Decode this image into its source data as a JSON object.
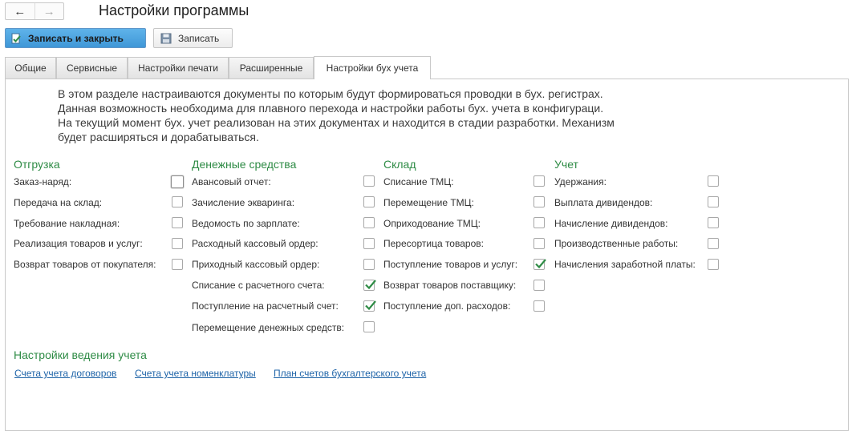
{
  "window": {
    "title": "Настройки программы",
    "nav": {
      "back_icon": "←",
      "forward_icon": "→"
    }
  },
  "toolbar": {
    "save_close_label": "Записать и закрыть",
    "save_label": "Записать"
  },
  "tabs": [
    {
      "label": "Общие",
      "active": false
    },
    {
      "label": "Сервисные",
      "active": false
    },
    {
      "label": "Настройки печати",
      "active": false
    },
    {
      "label": "Расширенные",
      "active": false
    },
    {
      "label": "Настройки бух учета",
      "active": true
    }
  ],
  "description": [
    "В этом разделе настраиваются документы по которым будут формироваться проводки в бух. регистрах.",
    "Данная возможность необходима для плавного перехода и настройки работы бух. учета в конфигураци.",
    "На текущий момент бух. учет реализован на этих документах и находится в стадии разработки. Механизм",
    "будет расширяться и дорабатываться."
  ],
  "sections": [
    {
      "title": "Отгрузка",
      "items": [
        {
          "label": "Заказ-наряд:",
          "checked": false
        },
        {
          "label": "Передача на склад:",
          "checked": false
        },
        {
          "label": "Требование накладная:",
          "checked": false
        },
        {
          "label": "Реализация товаров и услуг:",
          "checked": false
        },
        {
          "label": "Возврат товаров от покупателя:",
          "checked": false
        }
      ]
    },
    {
      "title": "Денежные средства",
      "items": [
        {
          "label": "Авансовый отчет:",
          "checked": false
        },
        {
          "label": "Зачисление экваринга:",
          "checked": false
        },
        {
          "label": "Ведомость по зарплате:",
          "checked": false
        },
        {
          "label": "Расходный кассовый ордер:",
          "checked": false
        },
        {
          "label": "Приходный кассовый ордер:",
          "checked": false
        },
        {
          "label": "Списание с расчетного счета:",
          "checked": true
        },
        {
          "label": "Поступление на расчетный счет:",
          "checked": true
        },
        {
          "label": "Перемещение денежных средств:",
          "checked": false
        }
      ]
    },
    {
      "title": "Склад",
      "items": [
        {
          "label": "Списание ТМЦ:",
          "checked": false
        },
        {
          "label": "Перемещение ТМЦ:",
          "checked": false
        },
        {
          "label": "Оприходование ТМЦ:",
          "checked": false
        },
        {
          "label": "Пересортица товаров:",
          "checked": false
        },
        {
          "label": "Поступление товаров и услуг:",
          "checked": true
        },
        {
          "label": "Возврат товаров поставщику:",
          "checked": false
        },
        {
          "label": "Поступление доп. расходов:",
          "checked": false
        }
      ]
    },
    {
      "title": "Учет",
      "items": [
        {
          "label": "Удержания:",
          "checked": false
        },
        {
          "label": "Выплата дивидендов:",
          "checked": false
        },
        {
          "label": "Начисление дивидендов:",
          "checked": false
        },
        {
          "label": "Производственные работы:",
          "checked": false
        },
        {
          "label": "Начисления заработной платы:",
          "checked": false
        }
      ]
    }
  ],
  "accounting_settings": {
    "title": "Настройки ведения учета",
    "links": [
      {
        "label": "Счета учета договоров"
      },
      {
        "label": "Счета учета номенклатуры"
      },
      {
        "label": "План счетов бухгалтерского учета"
      }
    ]
  },
  "colors": {
    "section_title": "#2e8b45",
    "check_mark": "#2e8b45",
    "link": "#1f64a8",
    "primary_button": "#4aa5e0"
  }
}
